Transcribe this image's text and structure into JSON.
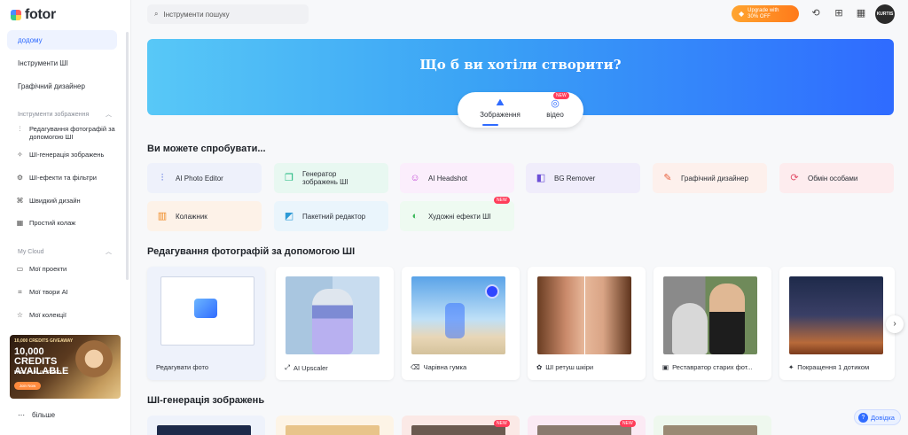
{
  "brand": {
    "name": "fotor"
  },
  "sidebar": {
    "nav": [
      {
        "label": "додому",
        "active": true
      },
      {
        "label": "Інструменти ШІ"
      },
      {
        "label": "Графічний дизайнер"
      }
    ],
    "image_tools": {
      "heading": "Інструменти зображення",
      "items": [
        {
          "label": "Редагування фотографій за допомогою ШІ",
          "icon": "sliders-icon"
        },
        {
          "label": "ШІ-генерація зображень",
          "icon": "image-spark-icon"
        },
        {
          "label": "ШІ-ефекти та фільтри",
          "icon": "effects-icon"
        },
        {
          "label": "Швидкий дизайн",
          "icon": "design-icon"
        },
        {
          "label": "Простий колаж",
          "icon": "collage-icon"
        }
      ]
    },
    "cloud": {
      "heading": "My Cloud",
      "items": [
        {
          "label": "Мої проекти",
          "icon": "folder-icon"
        },
        {
          "label": "Мої твори AI",
          "icon": "ai-works-icon"
        },
        {
          "label": "Мої колекції",
          "icon": "star-icon"
        }
      ]
    },
    "promo": {
      "kicker": "10,000 CREDITS GIVEAWAY",
      "headline": "10,000 CREDITS AVAILABLE",
      "sub": "FREE, FUN, INSPIRED",
      "button": "Join Now"
    },
    "more_label": "більше"
  },
  "header": {
    "search_placeholder": "Інструменти пошуку",
    "upgrade_line1": "Upgrade with",
    "upgrade_line2": "30% OFF",
    "avatar_text": "KURTIS"
  },
  "hero": {
    "title": "Що б ви хотіли створити?",
    "tabs": [
      {
        "label": "Зображення",
        "icon": "image-icon",
        "active": true
      },
      {
        "label": "відео",
        "icon": "video-icon",
        "badge": "NEW"
      }
    ]
  },
  "try_section": {
    "title": "Ви можете спробувати...",
    "tools": [
      {
        "label": "AI Photo Editor",
        "icon": "sliders-icon",
        "bg": "#eef1fb",
        "color": "#3b5bdb"
      },
      {
        "label": "Генератор зображень ШІ",
        "icon": "ai-generator-icon",
        "bg": "#e8f8f1",
        "color": "#18b67a"
      },
      {
        "label": "AI Headshot",
        "icon": "headshot-icon",
        "bg": "#fbeefc",
        "color": "#c24bd6"
      },
      {
        "label": "BG Remover",
        "icon": "bg-remover-icon",
        "bg": "#f0edfb",
        "color": "#6c4fd6"
      },
      {
        "label": "Графічний дизайнер",
        "icon": "design-tool-icon",
        "bg": "#fdf0ec",
        "color": "#e8603c"
      },
      {
        "label": "Обмін особами",
        "icon": "face-swap-icon",
        "bg": "#fdecee",
        "color": "#e2506a"
      },
      {
        "label": "Колажник",
        "icon": "collage-maker-icon",
        "bg": "#fdf2e8",
        "color": "#f08a24"
      },
      {
        "label": "Пакетний редактор",
        "icon": "batch-editor-icon",
        "bg": "#eaf5fc",
        "color": "#2d9ad6"
      },
      {
        "label": "Художні ефекти ШІ",
        "icon": "art-effects-icon",
        "bg": "#eefaf1",
        "color": "#3cb85a",
        "badge": "NEW"
      }
    ]
  },
  "edit_section": {
    "title": "Редагування фотографій за допомогою ШІ",
    "cards": [
      {
        "label": "Редагувати фото",
        "icon": ""
      },
      {
        "label": "AI Upscaler",
        "icon": "upscale-icon"
      },
      {
        "label": "Чарівна гумка",
        "icon": "eraser-icon"
      },
      {
        "label": "ШІ ретуш шкіри",
        "icon": "retouch-icon"
      },
      {
        "label": "Реставратор старих фот...",
        "icon": "restore-icon"
      },
      {
        "label": "Покращення 1 дотиком",
        "icon": "enhance-icon"
      }
    ]
  },
  "gen_section": {
    "title": "ШІ-генерація зображень",
    "badges": [
      "NEW",
      "NEW"
    ]
  },
  "help_label": "Довідка"
}
